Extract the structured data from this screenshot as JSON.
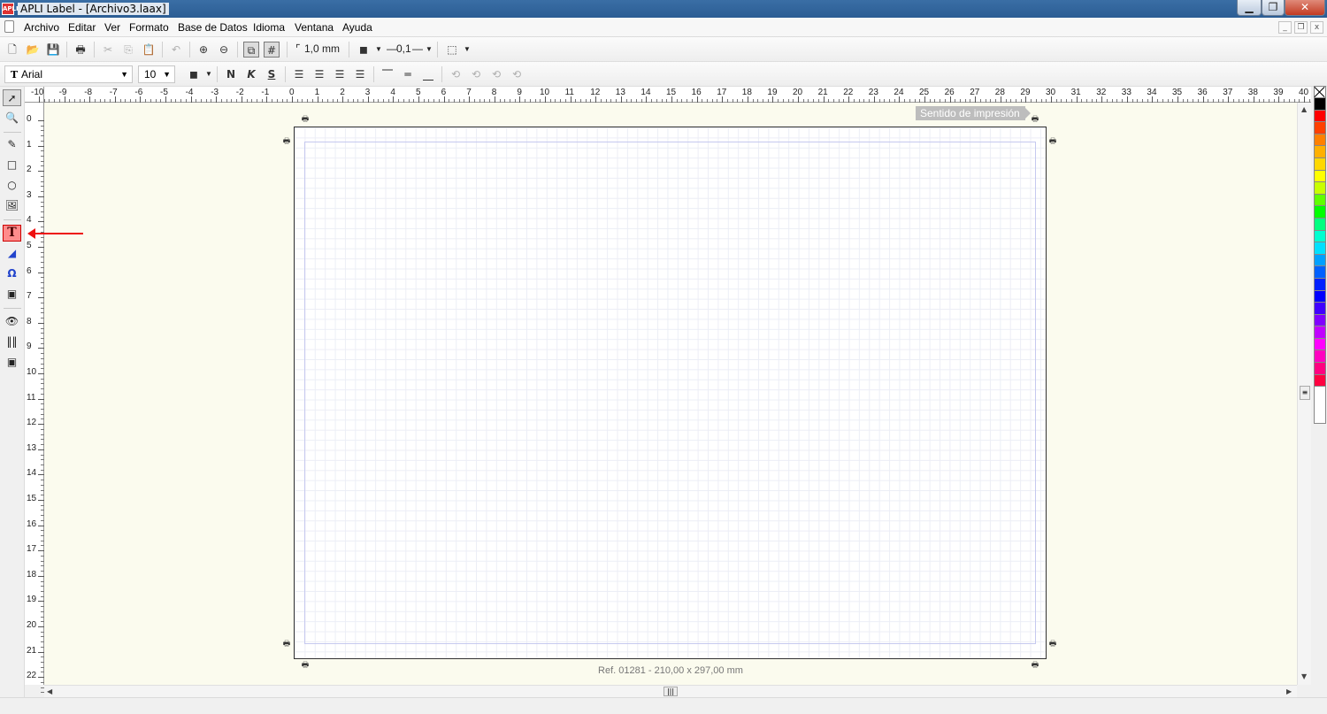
{
  "window": {
    "title": "APLI Label - [Archivo3.laax]",
    "app_icon_text": "APLI",
    "minimize": "▁",
    "maximize": "❐",
    "close": "✕"
  },
  "menu": {
    "items": [
      "Archivo",
      "Editar",
      "Ver",
      "Formato",
      "Base de Datos",
      "Idioma",
      "Ventana",
      "Ayuda"
    ],
    "mdi_minimize": "_",
    "mdi_restore": "❐",
    "mdi_close": "x"
  },
  "toolbar1": {
    "grid_size": "1,0 mm",
    "line_width": "0,1",
    "icons": [
      "new-icon",
      "open-icon",
      "save-icon",
      "print-icon",
      "cut-icon",
      "copy-icon",
      "paste-icon",
      "undo-icon",
      "zoom-in-icon",
      "zoom-out-icon",
      "snap-icon",
      "grid-icon",
      "fill-color-icon",
      "line-width-icon",
      "shadow-icon"
    ]
  },
  "toolbar2": {
    "font_name": "Arial",
    "font_size": "10",
    "bold": "N",
    "italic": "K",
    "underline": "S"
  },
  "rulers": {
    "h_labels": [
      "-10",
      "-9",
      "-8",
      "-7",
      "-6",
      "-5",
      "-4",
      "-3",
      "-2",
      "-1",
      "0",
      "1",
      "2",
      "3",
      "4",
      "5",
      "6",
      "7",
      "8",
      "9",
      "10",
      "11",
      "12",
      "13",
      "14",
      "15",
      "16",
      "17",
      "18",
      "19",
      "20",
      "21",
      "22",
      "23",
      "24",
      "25",
      "26",
      "27",
      "28",
      "29",
      "30",
      "31",
      "32",
      "33",
      "34",
      "35",
      "36",
      "37",
      "38",
      "39",
      "40"
    ],
    "v_labels": [
      "0",
      "1",
      "2",
      "3",
      "4",
      "5",
      "6",
      "7",
      "8",
      "9",
      "10",
      "11",
      "12",
      "13",
      "14",
      "15",
      "16",
      "17",
      "18",
      "19",
      "20",
      "21",
      "22"
    ]
  },
  "canvas": {
    "print_direction": "Sentido de impresión",
    "label_ref": "Ref. 01281 - 210,00 x 297,00 mm"
  },
  "left_tools": [
    "select-tool",
    "zoom-tool",
    "pencil-tool",
    "rectangle-tool",
    "ellipse-tool",
    "image-tool",
    "text-tool",
    "vertical-text-tool",
    "symbol-tool",
    "database-field-tool",
    "visibility-tool",
    "barcode-tool",
    "frame-tool"
  ],
  "selected_tool": "text-tool",
  "colors": {
    "palette": [
      "#000000",
      "#ff0000",
      "#ff4000",
      "#ff8000",
      "#ffb000",
      "#ffd800",
      "#ffff00",
      "#c8ff00",
      "#60ff00",
      "#00ff00",
      "#00ff80",
      "#00ffd0",
      "#00e0ff",
      "#00a0ff",
      "#0060ff",
      "#0020ff",
      "#0000ff",
      "#4000ff",
      "#8000ff",
      "#c000ff",
      "#ff00ff",
      "#ff00c0",
      "#ff0080",
      "#ff0040"
    ],
    "accent_red": "#ee1111",
    "canvas_bg": "#fbfbee"
  }
}
